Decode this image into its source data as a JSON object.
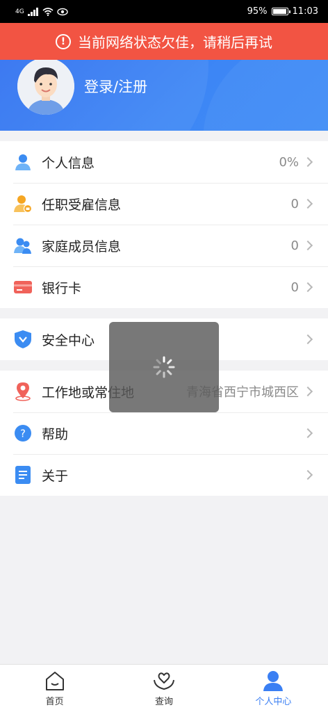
{
  "status_bar": {
    "network": "4G",
    "battery": "95%",
    "battery_level": 0.95,
    "time": "11:03"
  },
  "banner": {
    "text": "当前网络状态欠佳，请稍后再试",
    "color": "#f25443"
  },
  "profile": {
    "login_label": "登录/注册"
  },
  "group1": {
    "items": [
      {
        "label": "个人信息",
        "value": "0%",
        "icon": "person-icon"
      },
      {
        "label": "任职受雇信息",
        "value": "0",
        "icon": "employment-icon"
      },
      {
        "label": "家庭成员信息",
        "value": "0",
        "icon": "family-icon"
      },
      {
        "label": "银行卡",
        "value": "0",
        "icon": "bank-card-icon"
      }
    ]
  },
  "group2": {
    "items": [
      {
        "label": "安全中心",
        "value": "",
        "icon": "shield-icon"
      }
    ]
  },
  "group3": {
    "items": [
      {
        "label": "工作地或常住地",
        "value": "青海省西宁市城西区",
        "icon": "location-pin-icon"
      },
      {
        "label": "帮助",
        "value": "",
        "icon": "help-icon"
      },
      {
        "label": "关于",
        "value": "",
        "icon": "document-icon"
      }
    ]
  },
  "tabs": [
    {
      "label": "首页",
      "icon": "home-icon",
      "active": false
    },
    {
      "label": "查询",
      "icon": "heart-hands-icon",
      "active": false
    },
    {
      "label": "个人中心",
      "icon": "user-center-icon",
      "active": true
    }
  ],
  "colors": {
    "accent": "#3a7ff3",
    "header": "#2f6ef0",
    "banner": "#f25443"
  }
}
